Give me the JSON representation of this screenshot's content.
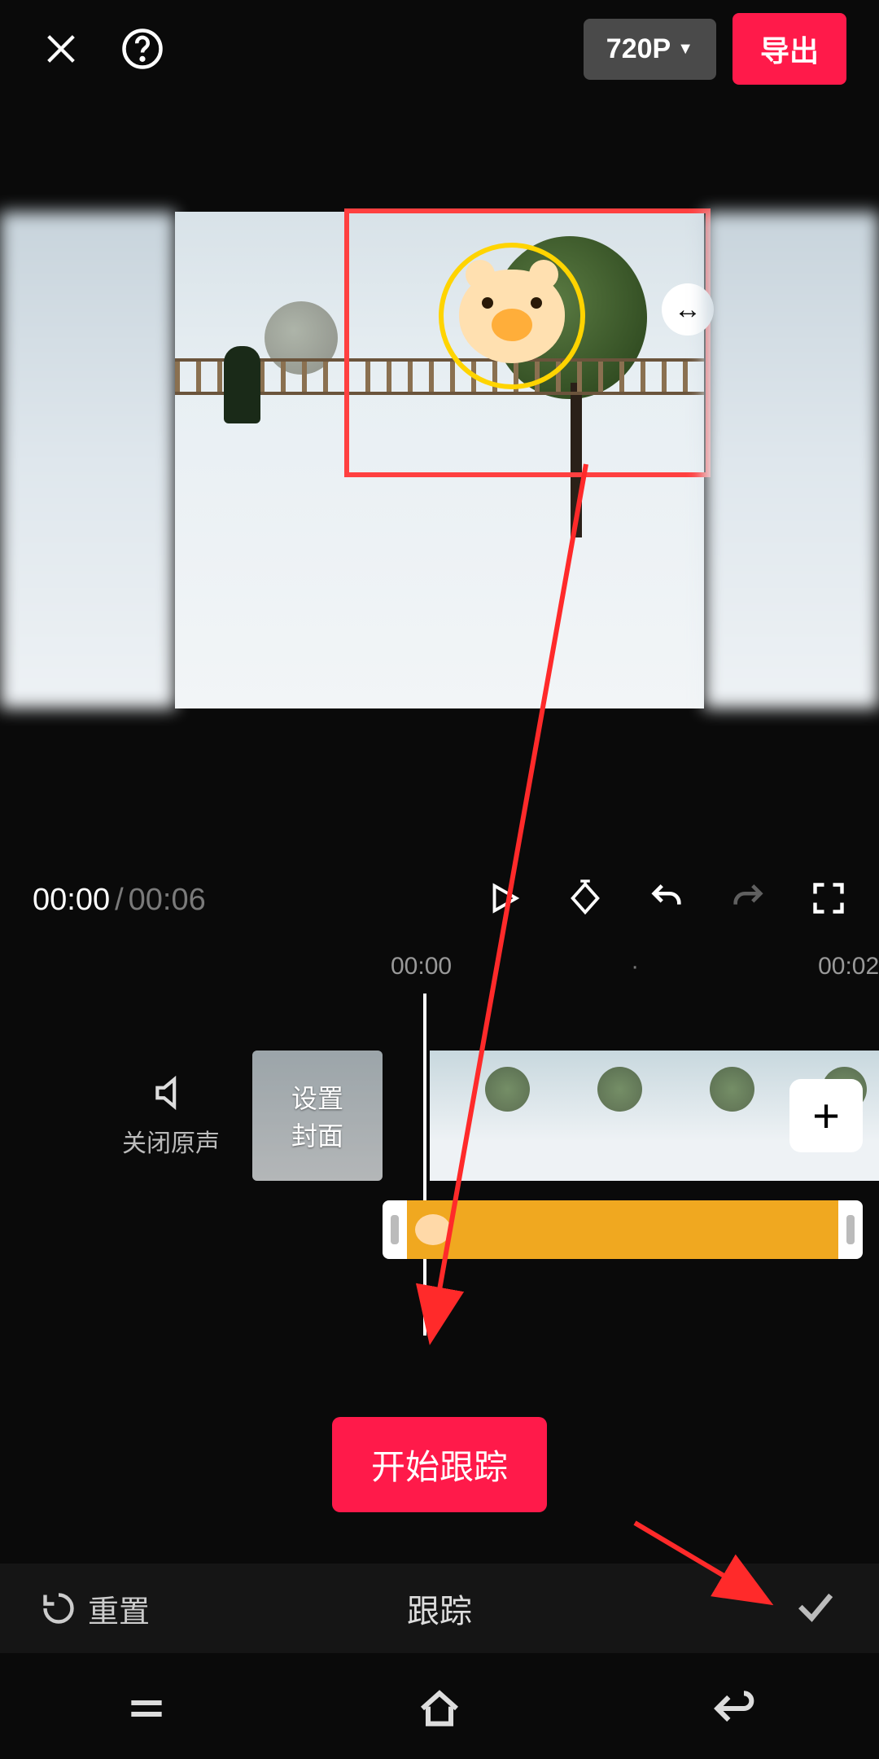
{
  "header": {
    "resolution_label": "720P",
    "export_label": "导出"
  },
  "playback": {
    "current_time": "00:00",
    "separator": "/",
    "total_time": "00:06"
  },
  "timeline": {
    "ruler": [
      "00:00",
      "·",
      "00:02",
      "·"
    ],
    "mute_label": "关闭原声",
    "cover_line1": "设置",
    "cover_line2": "封面"
  },
  "actions": {
    "start_tracking": "开始跟踪"
  },
  "toolbar": {
    "reset_label": "重置",
    "title": "跟踪"
  },
  "icons": {
    "resize_handle": "↔",
    "add": "+"
  }
}
